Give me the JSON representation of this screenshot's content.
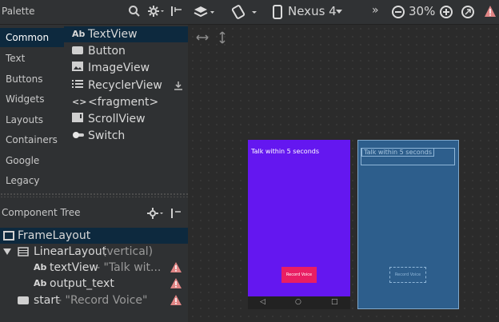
{
  "palette": {
    "title": "Palette",
    "categories": [
      "Common",
      "Text",
      "Buttons",
      "Widgets",
      "Layouts",
      "Containers",
      "Google",
      "Legacy"
    ],
    "widgets": [
      {
        "label": "TextView",
        "icon": "ab-text-icon"
      },
      {
        "label": "Button",
        "icon": "button-icon"
      },
      {
        "label": "ImageView",
        "icon": "image-icon"
      },
      {
        "label": "RecyclerView",
        "icon": "list-icon"
      },
      {
        "label": "<fragment>",
        "icon": "code-icon"
      },
      {
        "label": "ScrollView",
        "icon": "scroll-icon"
      },
      {
        "label": "Switch",
        "icon": "switch-icon"
      }
    ]
  },
  "toolbar": {
    "device": "Nexus 4",
    "zoom": "30%"
  },
  "tree": {
    "title": "Component Tree",
    "rows": [
      {
        "label": "FrameLayout",
        "extra": ""
      },
      {
        "label": "LinearLayout",
        "extra": "(vertical)"
      },
      {
        "label": "textView",
        "extra": "- \"Talk wit..."
      },
      {
        "label": "output_text",
        "extra": ""
      },
      {
        "label": "start",
        "extra": "- \"Record Voice\""
      }
    ]
  },
  "preview": {
    "text": "Talk within 5 seconds",
    "button": "Record Voice",
    "nav_back": "◁",
    "nav_home": "○",
    "nav_recent": "□"
  }
}
